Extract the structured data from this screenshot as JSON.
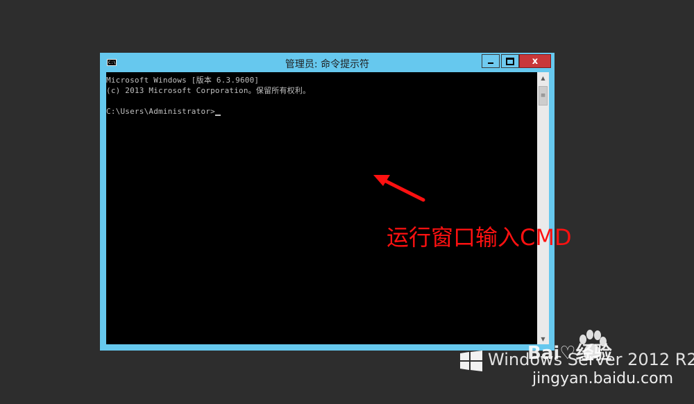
{
  "window": {
    "title": "管理员: 命令提示符",
    "icon_text": "C:\\",
    "controls": {
      "minimize": "minimize-icon",
      "maximize": "maximize-icon",
      "close": "close-icon"
    },
    "close_glyph": "x"
  },
  "console": {
    "lines": [
      "Microsoft Windows [版本 6.3.9600]",
      "(c) 2013 Microsoft Corporation。保留所有权利。",
      "",
      "C:\\Users\\Administrator>"
    ]
  },
  "annotation": {
    "text": "运行窗口输入CMD",
    "color": "#ff1111"
  },
  "branding": {
    "os_name": "Windows Server 2012 R2"
  },
  "watermark": {
    "brand": "Bai♡经验",
    "url": "jingyan.baidu.com"
  },
  "colors": {
    "desktop": "#2d2d2d",
    "window_frame": "#66c8ee",
    "close_button": "#c8383a",
    "console_bg": "#000000",
    "console_text": "#c0c0c0"
  }
}
